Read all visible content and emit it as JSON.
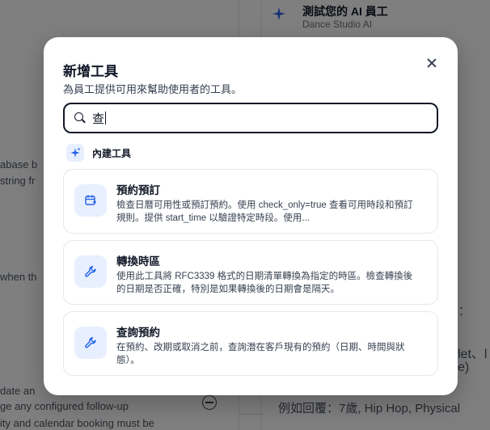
{
  "background": {
    "agent_title": "測試您的 AI 員工",
    "agent_subtitle": "Dance Studio AI",
    "left_fragments": [
      "abase b",
      "string fr",
      "when th",
      "date an",
      "ge any configured follow-up",
      "ity and calendar booking must be"
    ],
    "right_fragments": [
      ":",
      "let、l",
      "e)",
      "例如回覆：7歲, Hip Hop, Physical"
    ]
  },
  "modal": {
    "title": "新增工具",
    "subtitle": "為員工提供可用來幫助使用者的工具。",
    "search": {
      "value": "查",
      "placeholder": ""
    },
    "section_label": "內建工具",
    "tools": [
      {
        "name": "預約預訂",
        "icon": "calendar-plus-icon",
        "description": "檢查日曆可用性或預訂預約。使用 check_only=true 查看可用時段和預訂規則。提供 start_time 以驗證特定時段。使用..."
      },
      {
        "name": "轉換時區",
        "icon": "wrench-icon",
        "description": "使用此工具將 RFC3339 格式的日期清單轉換為指定的時區。檢查轉換後的日期是否正確，特別是如果轉換後的日期會是隔天。"
      },
      {
        "name": "查詢預約",
        "icon": "wrench-icon",
        "description": "在預約、改期或取消之前，查詢潛在客戶現有的預約（日期、時間與狀態）。"
      }
    ]
  },
  "colors": {
    "accent": "#2563eb",
    "accent_bg": "#e8efff",
    "overlay": "rgba(0,0,0,0.5)"
  }
}
